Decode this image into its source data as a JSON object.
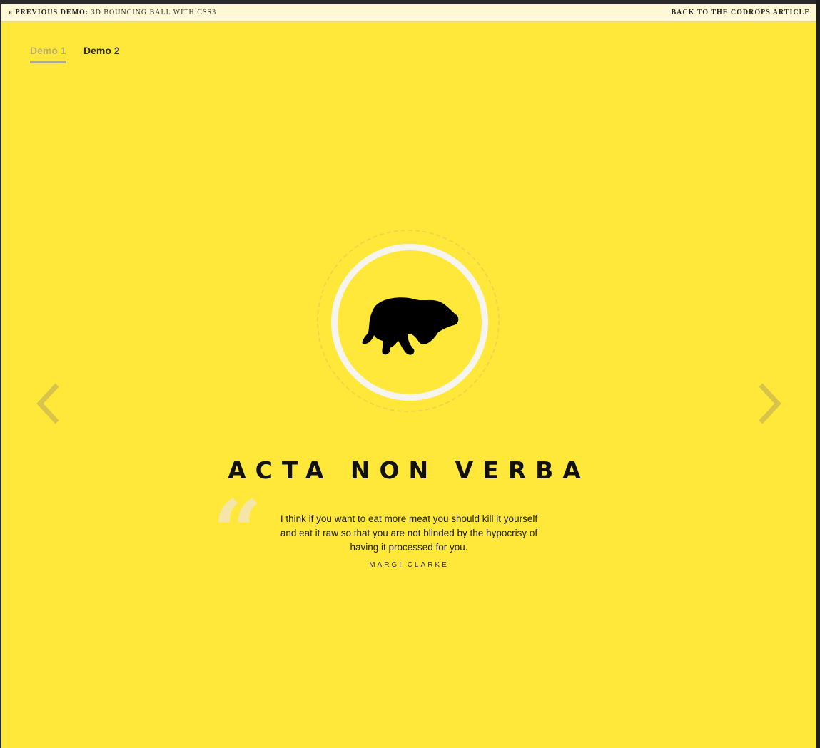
{
  "topbar": {
    "prev_prefix": "« Previous Demo:",
    "prev_title": "3D Bouncing Ball with CSS3",
    "back_label": "Back to the Codrops Article"
  },
  "tabs": [
    {
      "label": "Demo 1",
      "active": true
    },
    {
      "label": "Demo 2",
      "active": false
    }
  ],
  "slide": {
    "icon": "bear-icon",
    "title": "ACTA NON VERBA",
    "quote_mark": "“",
    "quote": "I think if you want to eat more meat you should kill it yourself and eat it raw so that you are not blinded by the hypocrisy of having it processed for you.",
    "author": "MARGI CLARKE"
  },
  "nav": {
    "prev_icon": "chevron-left-icon",
    "next_icon": "chevron-right-icon"
  },
  "colors": {
    "background": "#ffe83a",
    "ring": "#f5f4ee",
    "arrow": "#d8c44a"
  }
}
